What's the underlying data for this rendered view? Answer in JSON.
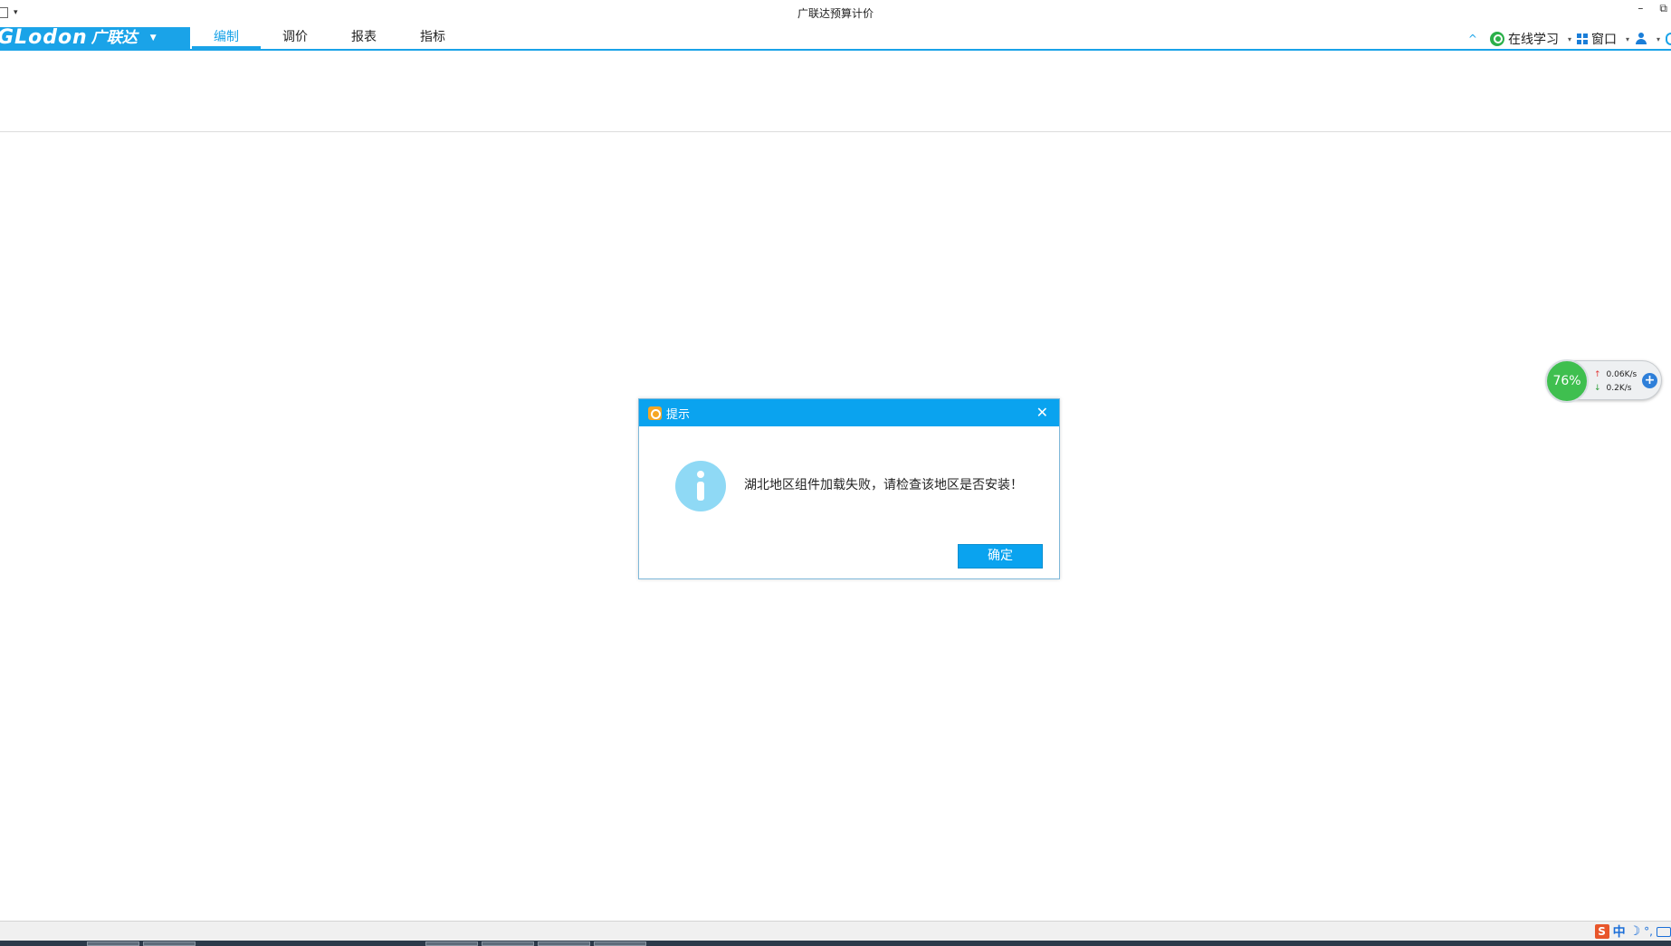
{
  "window": {
    "title": "广联达预算计价",
    "minimize_label": "–",
    "restore_label": "⧉",
    "qat_arrow": "▾"
  },
  "ribbon": {
    "brand": "GLodon",
    "brand_cn": "广联达",
    "brand_caret": "▼",
    "tabs": [
      {
        "label": "编制",
        "active": true
      },
      {
        "label": "调价",
        "active": false
      },
      {
        "label": "报表",
        "active": false
      },
      {
        "label": "指标",
        "active": false
      }
    ],
    "right": {
      "collapse_glyph": "^",
      "online_learning": "在线学习",
      "window": "窗口",
      "caret": "▾"
    }
  },
  "dialog": {
    "title": "提示",
    "close_glyph": "✕",
    "message": "湖北地区组件加载失败，请检查该地区是否安装！",
    "ok_label": "确定"
  },
  "network_monitor": {
    "percent": "76%",
    "upload": "0.06K/s",
    "download": "0.2K/s",
    "up_arrow": "↑",
    "down_arrow": "↓",
    "plus": "+"
  },
  "ime": {
    "logo": "S",
    "mode": "中",
    "moon": "☽",
    "punct": "°,"
  },
  "colors": {
    "accent": "#1aa3e8",
    "dialog_header": "#0aa3ef",
    "info_icon": "#8fd9f5",
    "net_ball": "#3fbf4f"
  }
}
